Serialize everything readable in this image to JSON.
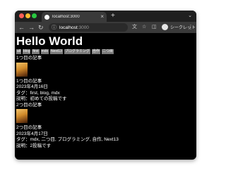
{
  "browser": {
    "tab_title": "localhost:3000",
    "tab_close": "×",
    "new_tab": "+",
    "address_host": "localhost",
    "address_port": ":3000",
    "profile_label": "シークレット",
    "colors": {
      "red": "#ff5f57",
      "yellow": "#febc2e",
      "green": "#28c840"
    },
    "icons": [
      "back-icon",
      "forward-icon",
      "reload-icon",
      "info-icon",
      "translate-icon",
      "star-icon",
      "sidepanel-icon",
      "incognito-avatar",
      "menu-icon"
    ]
  },
  "page": {
    "title": "Hello World",
    "tags": [
      "all",
      "blog",
      "first",
      "mdx",
      "Next13",
      "プログラミング",
      "自作",
      "二つ目"
    ],
    "articles": [
      {
        "heading": "1つ目の記事",
        "title": "1つ目の記事",
        "date": "2023年4月16日",
        "tags": "タグ：first, blog, mdx",
        "description": "説明：初めての投稿です"
      },
      {
        "heading": "2つ目の記事",
        "title": "2つ目の記事",
        "date": "2023年4月17日",
        "tags": "タグ：mdx, 二つ目, プログラミング, 自作, Next13",
        "description": "説明：2投稿です"
      }
    ]
  }
}
